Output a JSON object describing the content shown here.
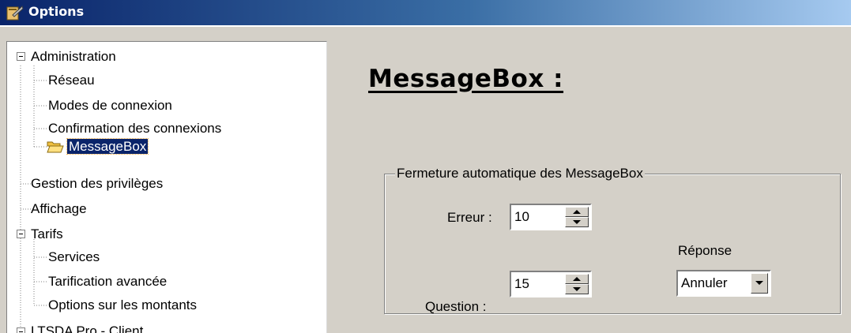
{
  "window": {
    "title": "Options"
  },
  "tree": {
    "nodes": [
      {
        "label": "Administration"
      },
      {
        "label": "Réseau"
      },
      {
        "label": "Modes de connexion"
      },
      {
        "label": "Confirmation des connexions"
      },
      {
        "label": "MessageBox",
        "selected": true
      },
      {
        "label": "Gestion des privilèges"
      },
      {
        "label": "Affichage"
      },
      {
        "label": "Tarifs"
      },
      {
        "label": "Services"
      },
      {
        "label": "Tarification avancée"
      },
      {
        "label": "Options sur les montants"
      },
      {
        "label": "LTSDA Pro - Client"
      }
    ]
  },
  "panel": {
    "title": "MessageBox :",
    "group": {
      "legend": "Fermeture automatique des MessageBox",
      "error_label": "Erreur :",
      "error_value": "10",
      "question_label": "Question :",
      "question_value": "15",
      "response_label": "Réponse",
      "response_value": "Annuler"
    }
  },
  "colors": {
    "titlebar_start": "#0a246a",
    "titlebar_end": "#a6caf0",
    "face": "#d4d0c8",
    "selection": "#0a246a"
  },
  "icons": [
    "options-app-icon",
    "open-folder-icon",
    "spin-up-icon",
    "spin-down-icon",
    "dropdown-arrow-icon"
  ]
}
